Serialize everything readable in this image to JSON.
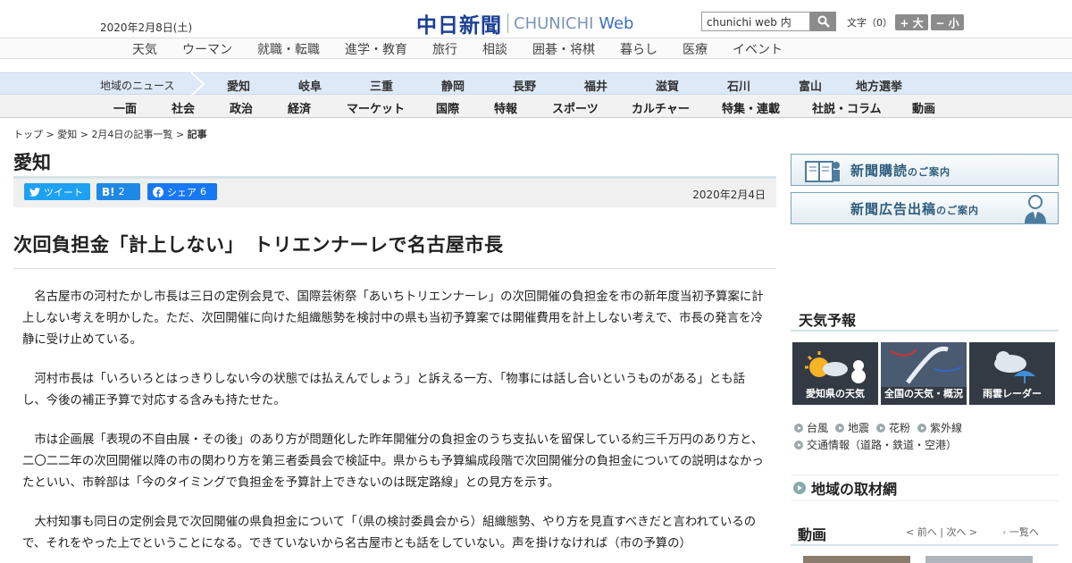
{
  "header": {
    "date": "2020年2月8日(土)",
    "logo_main": "中日新聞",
    "logo_sub_a": "CHUNICHI",
    "logo_sub_b": "Web",
    "search_value": "chunichi web 内",
    "font_size_label": "文字（0）",
    "font_larger": "+ 大",
    "font_smaller": "− 小"
  },
  "category_nav": [
    "天気",
    "ウーマン",
    "就職・転職",
    "進学・教育",
    "旅行",
    "相談",
    "囲碁・将棋",
    "暮らし",
    "医療",
    "イベント"
  ],
  "region_nav": {
    "label": "地域のニュース",
    "items": [
      "愛知",
      "岐阜",
      "三重",
      "静岡",
      "長野",
      "福井",
      "滋賀",
      "石川",
      "富山",
      "地方選挙"
    ]
  },
  "section_nav": [
    "一面",
    "社会",
    "政治",
    "経済",
    "マーケット",
    "国際",
    "特報",
    "スポーツ",
    "カルチャー",
    "特集・連載",
    "社説・コラム",
    "動画"
  ],
  "breadcrumb": {
    "items": [
      "トップ",
      "愛知",
      "2月4日の記事一覧"
    ],
    "sep": ">",
    "current": "記事"
  },
  "section_title": "愛知",
  "share": {
    "tweet_label": "ツイート",
    "hatena_label": "B!",
    "hatena_count": "2",
    "fb_label": "シェア",
    "fb_count": "6"
  },
  "article": {
    "date": "2020年2月4日",
    "headline": "次回負担金「計上しない」　トリエンナーレで名古屋市長",
    "paragraphs": [
      "名古屋市の河村たかし市長は三日の定例会見で、国際芸術祭「あいちトリエンナーレ」の次回開催の負担金を市の新年度当初予算案に計上しない考えを明かした。ただ、次回開催に向けた組織態勢を検討中の県も当初予算案では開催費用を計上しない考えで、市長の発言を冷静に受け止めている。",
      "河村市長は「いろいろとはっきりしない今の状態では払えんでしょう」と訴える一方、「物事には話し合いというものがある」とも話し、今後の補正予算で対応する含みも持たせた。",
      "市は企画展「表現の不自由展・その後」のあり方が問題化した昨年開催分の負担金のうち支払いを留保している約三千万円のあり方と、二〇二二年の次回開催以降の市の関わり方を第三者委員会で検証中。県からも予算編成段階で次回開催分の負担金についての説明はなかったといい、市幹部は「今のタイミングで負担金を予算計上できないのは既定路線」との見方を示す。",
      "大村知事も同日の定例会見で次回開催の県負担金について「（県の検討委員会から）組織態勢、やり方を見直すべきだと言われているので、それをやった上でということになる。できていないから名古屋市とも話をしていない。声を掛けなければ（市の予算の）"
    ]
  },
  "sidebar": {
    "banner_subscribe": "新聞購読",
    "banner_subscribe_suffix": "のご案内",
    "banner_ad": "新聞広告出稿",
    "banner_ad_suffix": "のご案内",
    "weather_title": "天気予報",
    "tiles": [
      "愛知県の天気",
      "全国の天気・概況",
      "雨雲レーダー"
    ],
    "weather_links_row1": [
      "台風",
      "地震",
      "花粉",
      "紫外線"
    ],
    "weather_link_traffic": "交通情報（道路・鉄道・空港）",
    "region_network": "地域の取材網",
    "video_title": "動画",
    "video_prev": "< 前へ",
    "video_sep": "|",
    "video_next": "次へ >",
    "video_all": "一覧へ"
  },
  "colors": {
    "logo_blue": "#1b3f96",
    "region_bar": "#dde9f6",
    "twitter": "#1da1f2",
    "hatena": "#1e88e5",
    "facebook": "#1877f2"
  }
}
